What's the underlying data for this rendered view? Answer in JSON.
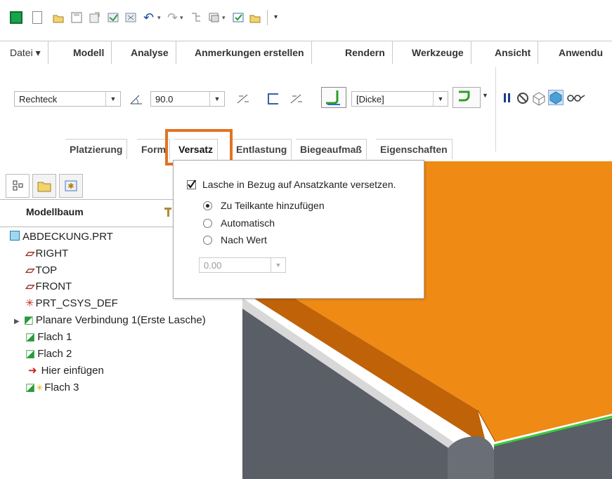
{
  "quick_access": {
    "icons": [
      "app-icon",
      "new-icon",
      "open-icon",
      "save-icon",
      "regenerate-icon",
      "window-icon",
      "close-window-icon",
      "undo-icon",
      "redo-icon",
      "find-icon",
      "switch-window-icon",
      "verify-icon",
      "folder-icon",
      "customize-icon"
    ]
  },
  "tabs": [
    "Datei ▾",
    "Modell",
    "Analyse",
    "Anmerkungen erstellen",
    "Rendern",
    "Werkzeuge",
    "Ansicht",
    "Anwendu"
  ],
  "ribbon": {
    "shape_value": "Rechteck",
    "angle_value": "90.0",
    "thickness_value": "[Dicke]"
  },
  "subtabs": [
    "Platzierung",
    "Form",
    "Versatz",
    "Entlastung",
    "Biegeaufmaß",
    "Eigenschaften"
  ],
  "left_tabs_title": "Modellbaum",
  "tree": [
    {
      "label": "ABDECKUNG.PRT",
      "icon": "part-icon"
    },
    {
      "label": "RIGHT",
      "icon": "datum-plane-icon"
    },
    {
      "label": "TOP",
      "icon": "datum-plane-icon"
    },
    {
      "label": "FRONT",
      "icon": "datum-plane-icon"
    },
    {
      "label": "PRT_CSYS_DEF",
      "icon": "csys-icon"
    },
    {
      "label": "Planare Verbindung 1(Erste Lasche)",
      "icon": "planar-icon"
    },
    {
      "label": "Flach 1",
      "icon": "flat-icon"
    },
    {
      "label": "Flach 2",
      "icon": "flat-icon"
    },
    {
      "label": "Hier einfügen",
      "icon": "insert-arrow-icon"
    },
    {
      "label": "Flach 3",
      "icon": "flat-icon"
    }
  ],
  "panel": {
    "checkbox_label": "Lasche in Bezug auf Ansatzkante versetzen.",
    "checkbox_checked": true,
    "options": [
      {
        "label": "Zu Teilkante hinzufügen",
        "selected": true
      },
      {
        "label": "Automatisch",
        "selected": false
      },
      {
        "label": "Nach Wert",
        "selected": false
      }
    ],
    "value": "0.00"
  },
  "colors": {
    "highlight": "#e37222",
    "sheet_orange": "#ef8a15",
    "sheet_edge": "#b35a00",
    "body_gray": "#5a5e66",
    "green_edge": "#3ccc3c"
  }
}
